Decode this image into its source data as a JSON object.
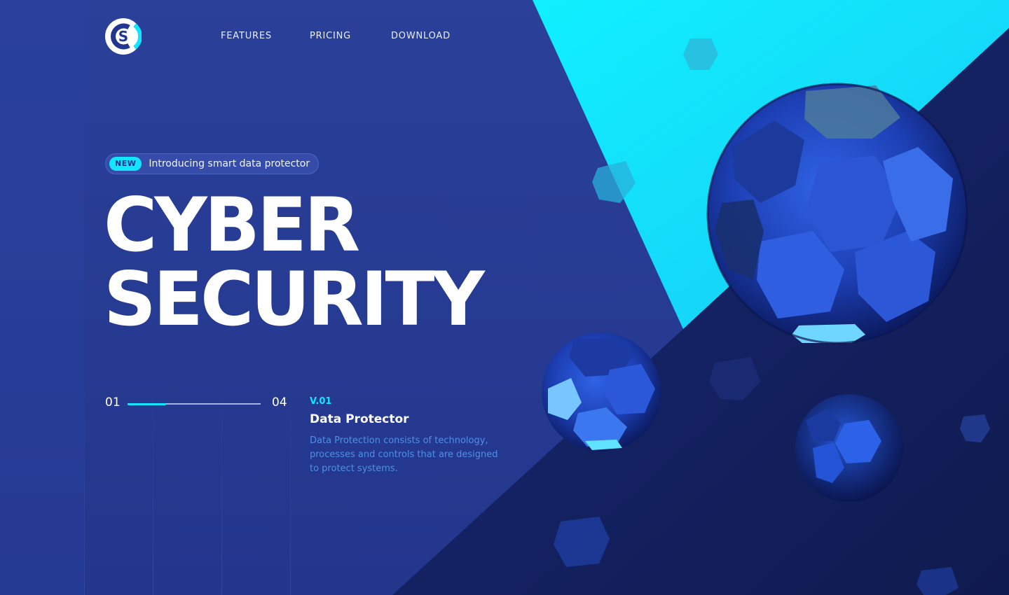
{
  "colors": {
    "background": "#263b96",
    "accent": "#12e6ff",
    "dark_panel": "#142062",
    "text": "#ffffff",
    "muted_text": "#4f8fe6"
  },
  "brand": {
    "logo_icon": "cs-monogram-logo"
  },
  "nav": {
    "items": [
      {
        "label": "FEATURES"
      },
      {
        "label": "PRICING"
      },
      {
        "label": "DOWNLOAD"
      }
    ]
  },
  "hero": {
    "badge": {
      "tag": "NEW",
      "text": "Introducing smart data protector"
    },
    "title_line1": "CYBER",
    "title_line2": "SECURITY"
  },
  "slider": {
    "current_label": "01",
    "total_label": "04",
    "progress": 0.29
  },
  "feature": {
    "version": "V.01",
    "title": "Data Protector",
    "description": "Data Protection consists of technology, processes and controls that are designed to protect systems."
  }
}
